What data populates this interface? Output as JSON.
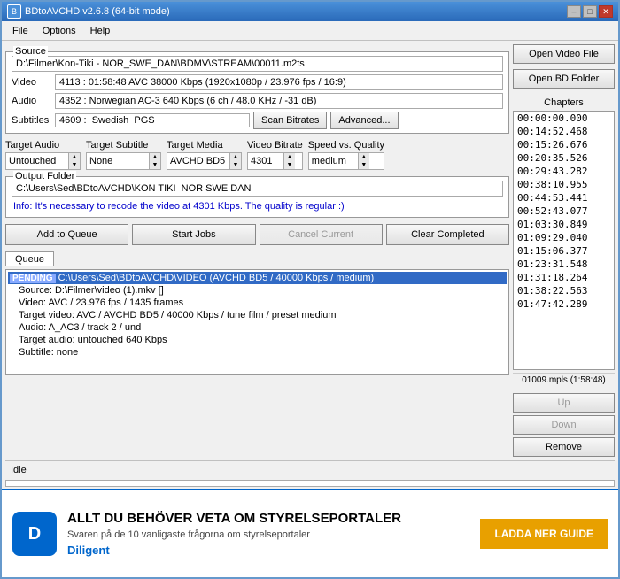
{
  "titlebar": {
    "title": "BDtoAVCHD v2.6.8  (64-bit mode)",
    "minimize": "–",
    "maximize": "□",
    "close": "✕"
  },
  "menu": {
    "items": [
      "File",
      "Options",
      "Help"
    ]
  },
  "source": {
    "label": "Source",
    "path": "D:\\Filmer\\Kon-Tiki - NOR_SWE_DAN\\BDMV\\STREAM\\00011.m2ts",
    "video_label": "Video",
    "video_value": "4113 :  01:58:48  AVC  38000 Kbps  (1920x1080p / 23.976 fps / 16:9)",
    "audio_label": "Audio",
    "audio_value": "4352 :  Norwegian  AC-3  640 Kbps  (6 ch / 48.0 KHz / -31 dB)",
    "subtitle_label": "Subtitles",
    "subtitle_value": "4609 :  Swedish  PGS"
  },
  "buttons": {
    "open_video": "Open Video File",
    "open_bd": "Open BD Folder",
    "scan_bitrates": "Scan Bitrates",
    "advanced": "Advanced...",
    "add_queue": "Add to Queue",
    "start_jobs": "Start Jobs",
    "cancel_current": "Cancel Current",
    "clear_completed": "Clear Completed"
  },
  "chapters": {
    "label": "Chapters",
    "items": [
      "00:00:00.000",
      "00:14:52.468",
      "00:15:26.676",
      "00:20:35.526",
      "00:29:43.282",
      "00:38:10.955",
      "00:44:53.441",
      "00:52:43.077",
      "01:03:30.849",
      "01:09:29.040",
      "01:15:06.377",
      "01:23:31.548",
      "01:31:18.264",
      "01:38:22.563",
      "01:47:42.289"
    ],
    "filename": "01009.mpls (1:58:48)"
  },
  "target": {
    "audio_label": "Target Audio",
    "audio_value": "Untouched",
    "subtitle_label": "Target Subtitle",
    "subtitle_value": "None",
    "media_label": "Target Media",
    "media_value": "AVCHD BD5",
    "bitrate_label": "Video Bitrate",
    "bitrate_value": "4301",
    "speed_label": "Speed vs. Quality",
    "speed_value": "medium"
  },
  "output": {
    "label": "Output Folder",
    "path": "C:\\Users\\Sed\\BDtoAVCHD\\KON TIKI  NOR SWE DAN",
    "info_text": "Info: It's necessary to recode the video at 4301 Kbps. The quality is regular :)"
  },
  "queue": {
    "tab_label": "Queue",
    "items": [
      {
        "status": "PENDING",
        "path": "C:\\Users\\Sed\\BDtoAVCHD\\VIDEO (AVCHD BD5 / 40000 Kbps / medium)",
        "details": [
          "Source: D:\\Filmer\\video (1).mkv  []",
          "Video: AVC / 23.976 fps / 1435 frames",
          "Target video: AVC / AVCHD BD5 / 40000 Kbps / tune film / preset medium",
          "Audio: A_AC3 / track 2 / und",
          "Target audio: untouched 640 Kbps",
          "Subtitle: none"
        ]
      }
    ]
  },
  "side_buttons": {
    "up": "Up",
    "down": "Down",
    "remove": "Remove"
  },
  "status": {
    "text": "Idle"
  },
  "ad": {
    "logo_text": "D",
    "title": "ALLT DU BEHÖVER VETA OM STYRELSEPORTALER",
    "subtitle": "Svaren på de 10 vanligaste frågorna om styrelseportaler",
    "brand": "Diligent",
    "cta_button": "LADDA NER GUIDE"
  }
}
